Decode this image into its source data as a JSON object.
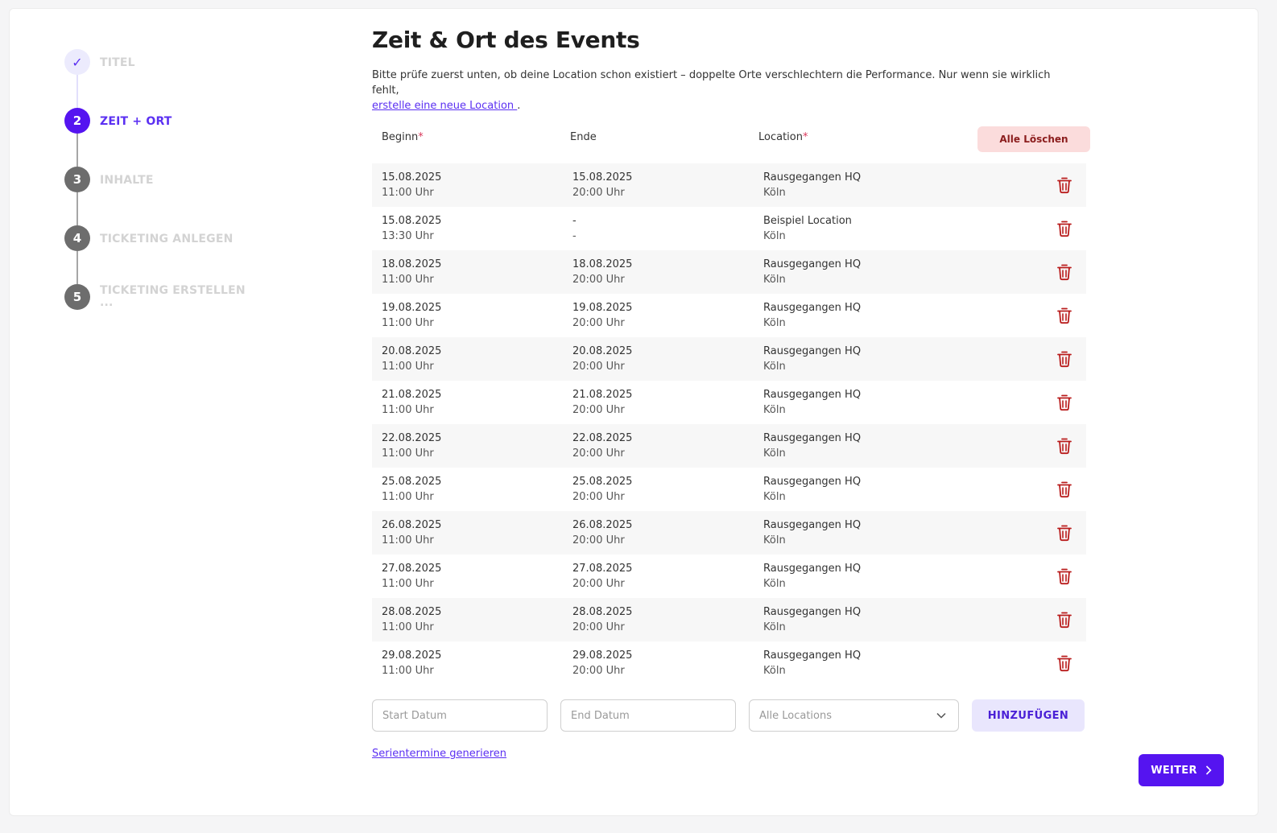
{
  "stepper": {
    "steps": [
      {
        "marker": "✓",
        "label": "TITEL",
        "state": "done"
      },
      {
        "marker": "2",
        "label": "ZEIT + ORT",
        "state": "active"
      },
      {
        "marker": "3",
        "label": "INHALTE",
        "state": "todo"
      },
      {
        "marker": "4",
        "label": "TICKETING ANLEGEN",
        "state": "todo"
      },
      {
        "marker": "5",
        "label": "TICKETING ERSTELLEN",
        "label_overflow": "...",
        "state": "todo"
      }
    ]
  },
  "page": {
    "title": "Zeit & Ort des Events",
    "intro_text": "Bitte prüfe zuerst unten, ob deine Location schon existiert – doppelte Orte verschlechtern die Performance. Nur wenn sie wirklich fehlt,",
    "intro_link": "erstelle eine neue Location ",
    "intro_end": "."
  },
  "table": {
    "headers": {
      "begin": "Beginn",
      "end": "Ende",
      "location": "Location",
      "required_mark": "*"
    },
    "clear_all_label": "Alle Löschen",
    "rows": [
      {
        "begin_date": "15.08.2025",
        "begin_time": "11:00 Uhr",
        "end_date": "15.08.2025",
        "end_time": "20:00 Uhr",
        "location": "Rausgegangen HQ",
        "city": "Köln"
      },
      {
        "begin_date": "15.08.2025",
        "begin_time": "13:30 Uhr",
        "end_date": "-",
        "end_time": "-",
        "location": "Beispiel Location",
        "city": "Köln"
      },
      {
        "begin_date": "18.08.2025",
        "begin_time": "11:00 Uhr",
        "end_date": "18.08.2025",
        "end_time": "20:00 Uhr",
        "location": "Rausgegangen HQ",
        "city": "Köln"
      },
      {
        "begin_date": "19.08.2025",
        "begin_time": "11:00 Uhr",
        "end_date": "19.08.2025",
        "end_time": "20:00 Uhr",
        "location": "Rausgegangen HQ",
        "city": "Köln"
      },
      {
        "begin_date": "20.08.2025",
        "begin_time": "11:00 Uhr",
        "end_date": "20.08.2025",
        "end_time": "20:00 Uhr",
        "location": "Rausgegangen HQ",
        "city": "Köln"
      },
      {
        "begin_date": "21.08.2025",
        "begin_time": "11:00 Uhr",
        "end_date": "21.08.2025",
        "end_time": "20:00 Uhr",
        "location": "Rausgegangen HQ",
        "city": "Köln"
      },
      {
        "begin_date": "22.08.2025",
        "begin_time": "11:00 Uhr",
        "end_date": "22.08.2025",
        "end_time": "20:00 Uhr",
        "location": "Rausgegangen HQ",
        "city": "Köln"
      },
      {
        "begin_date": "25.08.2025",
        "begin_time": "11:00 Uhr",
        "end_date": "25.08.2025",
        "end_time": "20:00 Uhr",
        "location": "Rausgegangen HQ",
        "city": "Köln"
      },
      {
        "begin_date": "26.08.2025",
        "begin_time": "11:00 Uhr",
        "end_date": "26.08.2025",
        "end_time": "20:00 Uhr",
        "location": "Rausgegangen HQ",
        "city": "Köln"
      },
      {
        "begin_date": "27.08.2025",
        "begin_time": "11:00 Uhr",
        "end_date": "27.08.2025",
        "end_time": "20:00 Uhr",
        "location": "Rausgegangen HQ",
        "city": "Köln"
      },
      {
        "begin_date": "28.08.2025",
        "begin_time": "11:00 Uhr",
        "end_date": "28.08.2025",
        "end_time": "20:00 Uhr",
        "location": "Rausgegangen HQ",
        "city": "Köln"
      },
      {
        "begin_date": "29.08.2025",
        "begin_time": "11:00 Uhr",
        "end_date": "29.08.2025",
        "end_time": "20:00 Uhr",
        "location": "Rausgegangen HQ",
        "city": "Köln"
      }
    ]
  },
  "add_form": {
    "start_placeholder": "Start Datum",
    "end_placeholder": "End Datum",
    "location_selected": "Alle Locations",
    "add_label": "HINZUFÜGEN"
  },
  "series_link": "Serientermine generieren",
  "next_label": "WEITER",
  "colors": {
    "accent": "#5514f0",
    "danger": "#b91c1c",
    "clear_bg": "#fbdcdc"
  }
}
